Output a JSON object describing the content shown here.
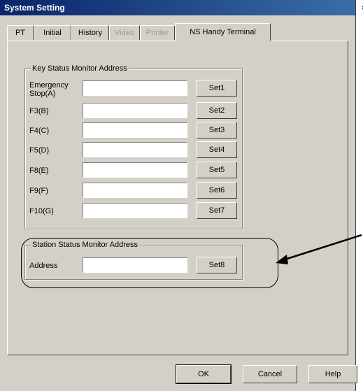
{
  "window": {
    "title": "System Setting",
    "close_glyph": "×"
  },
  "tabs": [
    {
      "label": "PT",
      "disabled": false
    },
    {
      "label": "Initial",
      "disabled": false
    },
    {
      "label": "History",
      "disabled": false
    },
    {
      "label": "Video",
      "disabled": true
    },
    {
      "label": "Printer",
      "disabled": true
    },
    {
      "label": "NS Handy Terminal",
      "active": true
    }
  ],
  "key_status": {
    "title": "Key Status Monitor Address",
    "rows": [
      {
        "label_line1": "Emergency",
        "label_line2": "Stop(A)",
        "value": "",
        "button": "Set1"
      },
      {
        "label": "F3(B)",
        "value": "",
        "button": "Set2"
      },
      {
        "label": "F4(C)",
        "value": "",
        "button": "Set3"
      },
      {
        "label": "F5(D)",
        "value": "",
        "button": "Set4"
      },
      {
        "label": "F8(E)",
        "value": "",
        "button": "Set5"
      },
      {
        "label": "F9(F)",
        "value": "",
        "button": "Set6"
      },
      {
        "label": "F10(G)",
        "value": "",
        "button": "Set7"
      }
    ]
  },
  "station_status": {
    "title": "Station Status Monitor Address",
    "label": "Address",
    "value": "",
    "button": "Set8"
  },
  "buttons": {
    "ok": "OK",
    "cancel": "Cancel",
    "help": "Help"
  }
}
